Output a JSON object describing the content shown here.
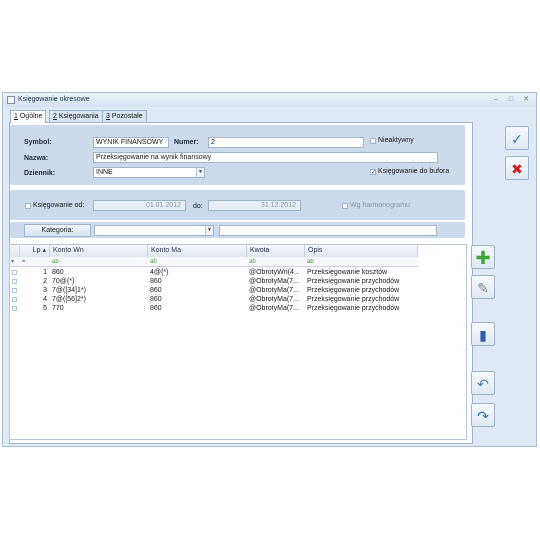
{
  "window": {
    "title": "Księgowanie okresowe"
  },
  "tabs": [
    {
      "num": "1",
      "label": " Ogólne"
    },
    {
      "num": "2",
      "label": " Księgowania"
    },
    {
      "num": "3",
      "label": " Pozostałe"
    }
  ],
  "form": {
    "symbol_label": "Symbol:",
    "symbol_value": "WYNIK FINANSOWY",
    "numer_label": "Numer:",
    "numer_value": "2",
    "nieaktywny_label": "Nieaktywny",
    "nazwa_label": "Nazwa:",
    "nazwa_value": "Przeksięgowanie na wynik finansowy",
    "dziennik_label": "Dziennik:",
    "dziennik_value": "INNE",
    "bufor_label": "Księgowanie do bufora",
    "ksiegowanie_od_label": "Księgowanie od:",
    "date_from": "01.01.2012",
    "do_label": "do:",
    "date_to": "31.12.2012",
    "harmonogram_label": "Wg harmonogramu",
    "kategoria_label": "Kategoria:",
    "kategoria_value": "",
    "kategoria_desc": ""
  },
  "grid": {
    "columns": [
      "Lp",
      "Konto Wn",
      "Konto Ma",
      "Kwota",
      "Opis"
    ],
    "filter_glyph": "≈",
    "filter_marks": [
      "ab",
      "ab",
      "ab",
      "ab"
    ],
    "sort_glyph": "▴",
    "rows": [
      {
        "lp": "1",
        "wn": "860",
        "ma": "4@{*}",
        "kwota": "@ObrotyWn(4...",
        "opis": "Przeksięgowanie kosztów"
      },
      {
        "lp": "2",
        "wn": "70@{*}",
        "ma": "860",
        "kwota": "@ObrotyMa(7...",
        "opis": "Przeksięgowanie przychodów"
      },
      {
        "lp": "3",
        "wn": "7@([34]1*)",
        "ma": "860",
        "kwota": "@ObrotyMa(7...",
        "opis": "Przeksięgowanie przychodów"
      },
      {
        "lp": "4",
        "wn": "7@([56]2*)",
        "ma": "860",
        "kwota": "@ObrotyMa(7...",
        "opis": "Przeksięgowanie przychodów"
      },
      {
        "lp": "5",
        "wn": "770",
        "ma": "860",
        "kwota": "@ObrotyMa(7...",
        "opis": "Przeksięgowanie przychodów"
      }
    ]
  },
  "icons": {
    "save": "save-icon",
    "cancel": "cancel-icon",
    "add": "add-icon",
    "edit": "edit-icon",
    "delete": "delete-icon",
    "undo": "undo-icon",
    "redo": "redo-icon"
  },
  "colors": {
    "accent": "#1e395b",
    "add_green": "#3fa535",
    "cancel_red": "#cc1f1f"
  }
}
